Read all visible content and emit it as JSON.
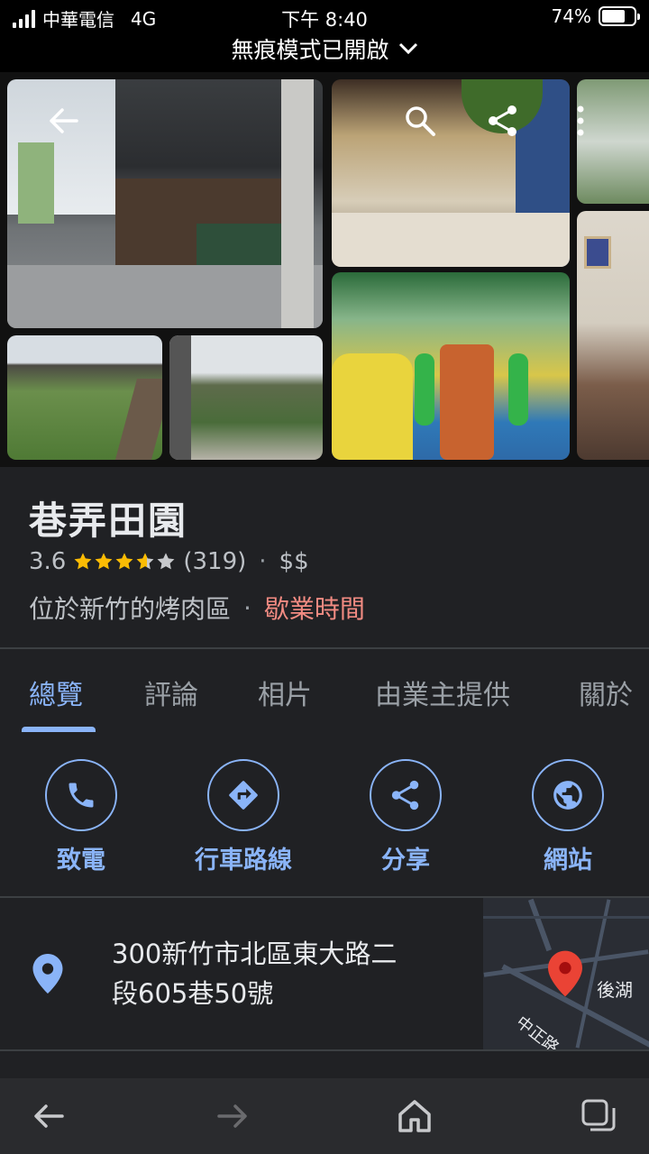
{
  "status_bar": {
    "carrier": "中華電信",
    "network": "4G",
    "time": "下午 8:40",
    "battery_percent": "74%",
    "battery_level": 0.74,
    "incognito_label": "無痕模式已開啟"
  },
  "place": {
    "name": "巷弄田園",
    "rating": "3.6",
    "star_value": 3.6,
    "review_count": "(319)",
    "price": "$$",
    "category": "位於新竹的烤肉區",
    "hours_label": "歇業時間",
    "hours_color": "#f28b82"
  },
  "tabs": [
    {
      "label": "總覽",
      "active": true
    },
    {
      "label": "評論",
      "active": false
    },
    {
      "label": "相片",
      "active": false
    },
    {
      "label": "由業主提供",
      "active": false
    },
    {
      "label": "關於",
      "active": false
    }
  ],
  "actions": [
    {
      "label": "致電",
      "icon": "phone-icon"
    },
    {
      "label": "行車路線",
      "icon": "directions-icon"
    },
    {
      "label": "分享",
      "icon": "share-icon"
    },
    {
      "label": "網站",
      "icon": "globe-icon"
    }
  ],
  "address": {
    "line1": "300新竹市北區東大路二",
    "line2": "段605巷50號",
    "map_labels": {
      "area": "後湖",
      "road": "中正路"
    }
  },
  "accent_color": "#8ab4f8",
  "toolbar": {
    "icons": [
      "back-arrow-icon",
      "forward-arrow-icon",
      "home-icon",
      "tabs-icon"
    ]
  }
}
